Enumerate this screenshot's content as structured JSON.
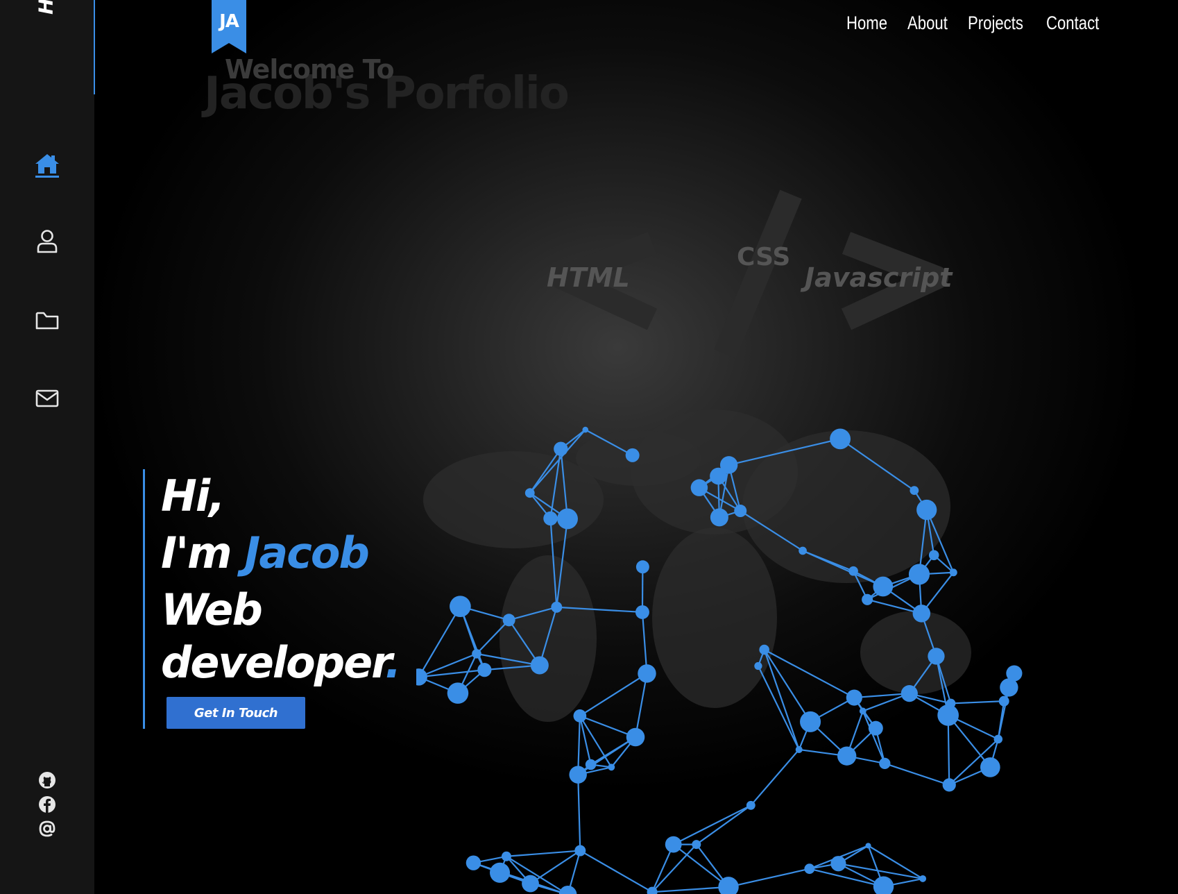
{
  "sidebar": {
    "active_tab_label": "Home",
    "nav_icons": [
      "home-icon",
      "user-icon",
      "folder-icon",
      "mail-icon"
    ],
    "social_icons": [
      "github-icon",
      "facebook-icon",
      "at-sign-icon"
    ]
  },
  "logo": {
    "text": "JA"
  },
  "welcome": {
    "line1": "Welcome To",
    "line2": "Jacob's Porfolio"
  },
  "nav": {
    "home": "Home",
    "about": "About",
    "projects": "Projects",
    "contact": "Contact"
  },
  "code_graphic": {
    "html": "HTML",
    "css": "CSS",
    "javascript": "Javascript"
  },
  "hero": {
    "greeting": "Hi,",
    "intro_prefix": "I'm ",
    "name": "Jacob",
    "role_line1": "Web",
    "role_line2": "developer",
    "role_suffix": ".",
    "cta_label": "Get In Touch"
  },
  "colors": {
    "accent": "#3a8ee6",
    "button": "#3070d0",
    "sidebar_bg": "#151515",
    "background": "#000000"
  }
}
